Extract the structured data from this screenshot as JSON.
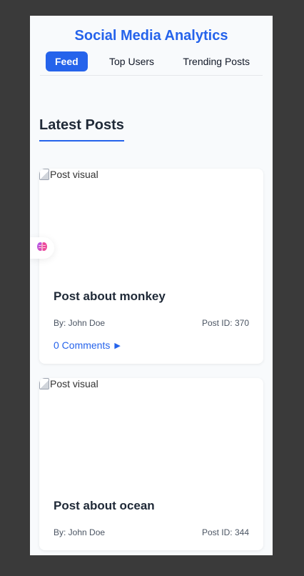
{
  "app": {
    "title": "Social Media Analytics"
  },
  "nav": {
    "tabs": [
      {
        "label": "Feed",
        "active": true
      },
      {
        "label": "Top Users",
        "active": false
      },
      {
        "label": "Trending Posts",
        "active": false
      }
    ]
  },
  "section": {
    "title": "Latest Posts"
  },
  "posts": [
    {
      "image_alt": "Post visual",
      "title": "Post about monkey",
      "author": "By: John Doe",
      "post_id": "Post ID: 370",
      "comments": "0 Comments"
    },
    {
      "image_alt": "Post visual",
      "title": "Post about ocean",
      "author": "By: John Doe",
      "post_id": "Post ID: 344"
    }
  ],
  "icons": {
    "expand": "triangle-right-icon",
    "assistant": "brain-icon",
    "broken_image": "broken-image-icon"
  },
  "colors": {
    "accent": "#2563eb",
    "background": "#f8fafc",
    "text": "#1f2937"
  }
}
